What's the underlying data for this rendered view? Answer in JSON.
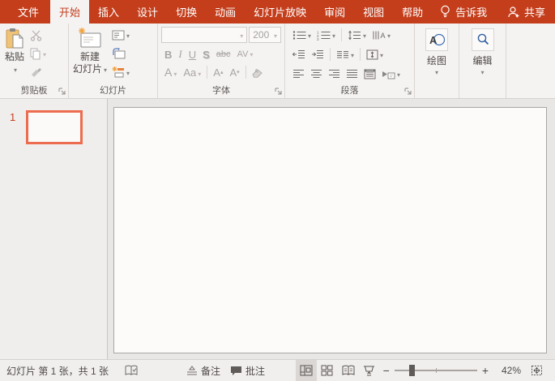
{
  "app": {
    "accent_color": "#C43E1C",
    "selection_color": "#ED6B4E"
  },
  "tabbar": {
    "tabs": [
      {
        "label": "文件",
        "active": false
      },
      {
        "label": "开始",
        "active": true
      },
      {
        "label": "插入",
        "active": false
      },
      {
        "label": "设计",
        "active": false
      },
      {
        "label": "切换",
        "active": false
      },
      {
        "label": "动画",
        "active": false
      },
      {
        "label": "幻灯片放映",
        "active": false
      },
      {
        "label": "审阅",
        "active": false
      },
      {
        "label": "视图",
        "active": false
      },
      {
        "label": "帮助",
        "active": false
      }
    ],
    "tell_me": "告诉我",
    "share": "共享"
  },
  "ribbon": {
    "clipboard": {
      "label": "剪贴板",
      "paste_label": "粘贴"
    },
    "slides": {
      "label": "幻灯片",
      "new_slide_line1": "新建",
      "new_slide_line2": "幻灯片"
    },
    "font": {
      "label": "字体",
      "font_name_value": "",
      "font_size_value": "200",
      "bold_label": "B",
      "italic_label": "I",
      "underline_label": "U",
      "shadow_label": "S",
      "strikethrough_label": "abc",
      "spacing_label": "AV",
      "font_color_label": "A",
      "change_case_label": "Aa",
      "grow_font_label": "A",
      "shrink_font_label": "A"
    },
    "paragraph": {
      "label": "段落"
    },
    "drawing": {
      "label": "绘图"
    },
    "editing": {
      "label": "编辑"
    }
  },
  "slide_panel": {
    "slide_number": "1"
  },
  "status_bar": {
    "slide_info": "幻灯片 第 1 张，共 1 张",
    "notes_label": "备注",
    "comments_label": "批注",
    "zoom_out_glyph": "−",
    "zoom_in_glyph": "+",
    "zoom_percent": "42%"
  }
}
